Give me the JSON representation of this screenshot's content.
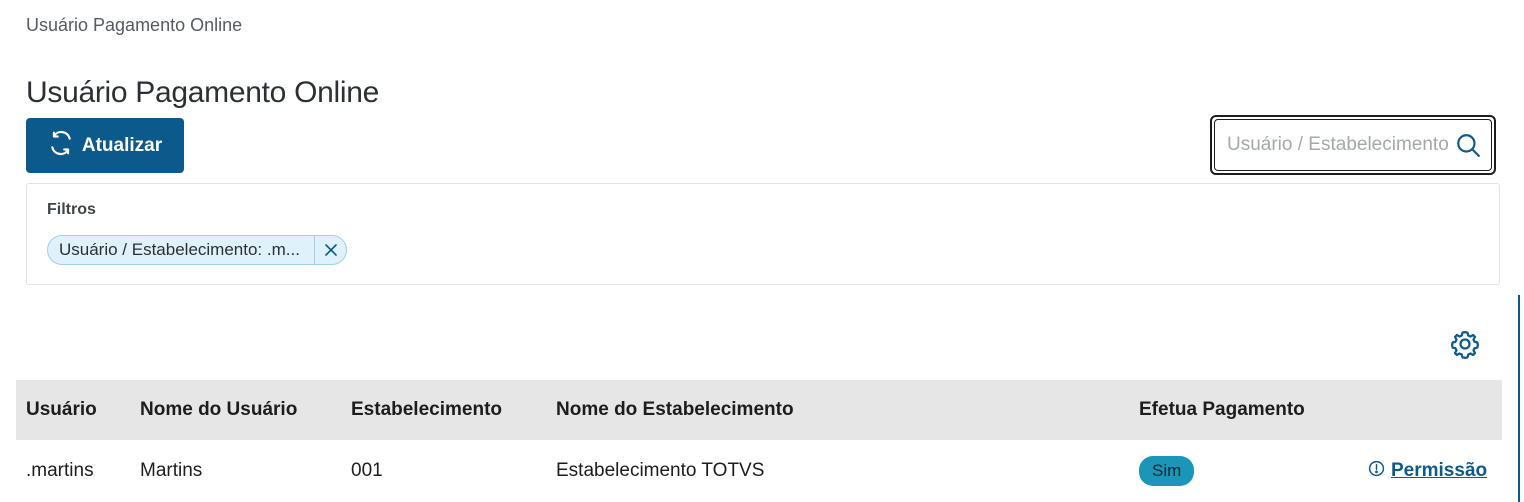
{
  "breadcrumb": "Usuário Pagamento Online",
  "page_title": "Usuário Pagamento Online",
  "toolbar": {
    "refresh_label": "Atualizar"
  },
  "search": {
    "placeholder": "Usuário / Estabelecimento",
    "value": ""
  },
  "filters": {
    "title": "Filtros",
    "chips": [
      {
        "label": "Usuário / Estabelecimento: .m..."
      }
    ]
  },
  "table": {
    "columns": [
      "Usuário",
      "Nome do Usuário",
      "Estabelecimento",
      "Nome do Estabelecimento",
      "Efetua Pagamento"
    ],
    "rows": [
      {
        "usuario": ".martins",
        "nome_usuario": "Martins",
        "estabelecimento": "001",
        "nome_estabelecimento": "Estabelecimento TOTVS",
        "efetua_pagamento": "Sim",
        "action": "Permissão"
      }
    ]
  },
  "colors": {
    "primary": "#0c5a8b",
    "badge": "#1b96b8",
    "header_bg": "#e6e6e6",
    "chip_bg": "#dff2fb"
  },
  "icons": {
    "refresh": "refresh-icon",
    "search": "search-icon",
    "close": "close-icon",
    "settings": "gear-icon",
    "info": "info-circle-icon"
  }
}
